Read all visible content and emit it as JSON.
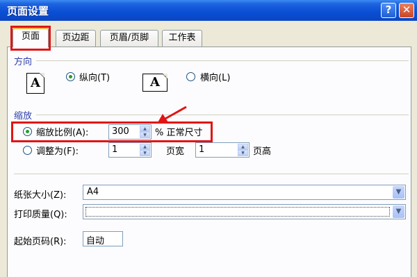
{
  "window": {
    "title": "页面设置",
    "help_label": "?",
    "close_label": "✕"
  },
  "tabs": [
    {
      "label": "页面",
      "active": true
    },
    {
      "label": "页边距",
      "active": false
    },
    {
      "label": "页眉/页脚",
      "active": false
    },
    {
      "label": "工作表",
      "active": false
    }
  ],
  "orientation": {
    "section_label": "方向",
    "portrait": {
      "label": "纵向(T)",
      "selected": true,
      "icon_letter": "A"
    },
    "landscape": {
      "label": "横向(L)",
      "selected": false,
      "icon_letter": "A"
    }
  },
  "scaling": {
    "section_label": "缩放",
    "adjust_to": {
      "label": "缩放比例(A):",
      "selected": true,
      "value": "300",
      "suffix": "% 正常尺寸"
    },
    "fit_to": {
      "label": "调整为(F):",
      "selected": false,
      "pages_wide": "1",
      "wide_label": "页宽",
      "pages_tall": "1",
      "tall_label": "页高"
    }
  },
  "paper_size": {
    "label": "纸张大小(Z):",
    "value": "A4"
  },
  "print_quality": {
    "label": "打印质量(Q):",
    "value": ""
  },
  "first_page_number": {
    "label": "起始页码(R):",
    "value": "自动"
  },
  "colors": {
    "accent_red": "#e01515",
    "section_blue": "#2b3da8",
    "titlebar_blue": "#0a4fd6"
  }
}
